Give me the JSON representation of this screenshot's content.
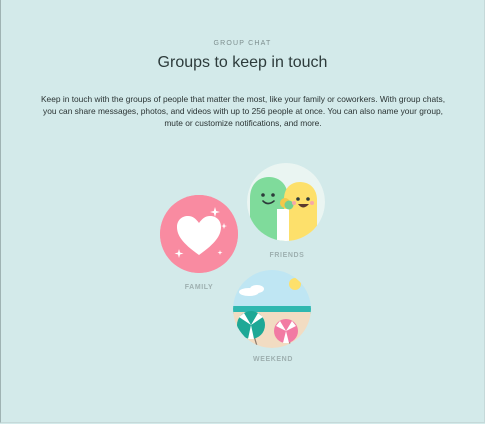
{
  "header": {
    "eyebrow": "GROUP CHAT",
    "title": "Groups to keep in touch",
    "description": "Keep in touch with the groups of people that matter the most, like your family or coworkers. With group chats, you can share messages, photos, and videos with up to 256 people at once. You can also name your group, mute or customize notifications, and more."
  },
  "groups": {
    "family": {
      "label": "FAMILY",
      "icon": "heart-icon",
      "color": "#f98ba1"
    },
    "friends": {
      "label": "FRIENDS",
      "icon": "friends-faces-icon",
      "color": "#e9f5f3"
    },
    "weekend": {
      "label": "WEEKEND",
      "icon": "beach-umbrellas-icon",
      "color": "#bfe3f0"
    }
  }
}
